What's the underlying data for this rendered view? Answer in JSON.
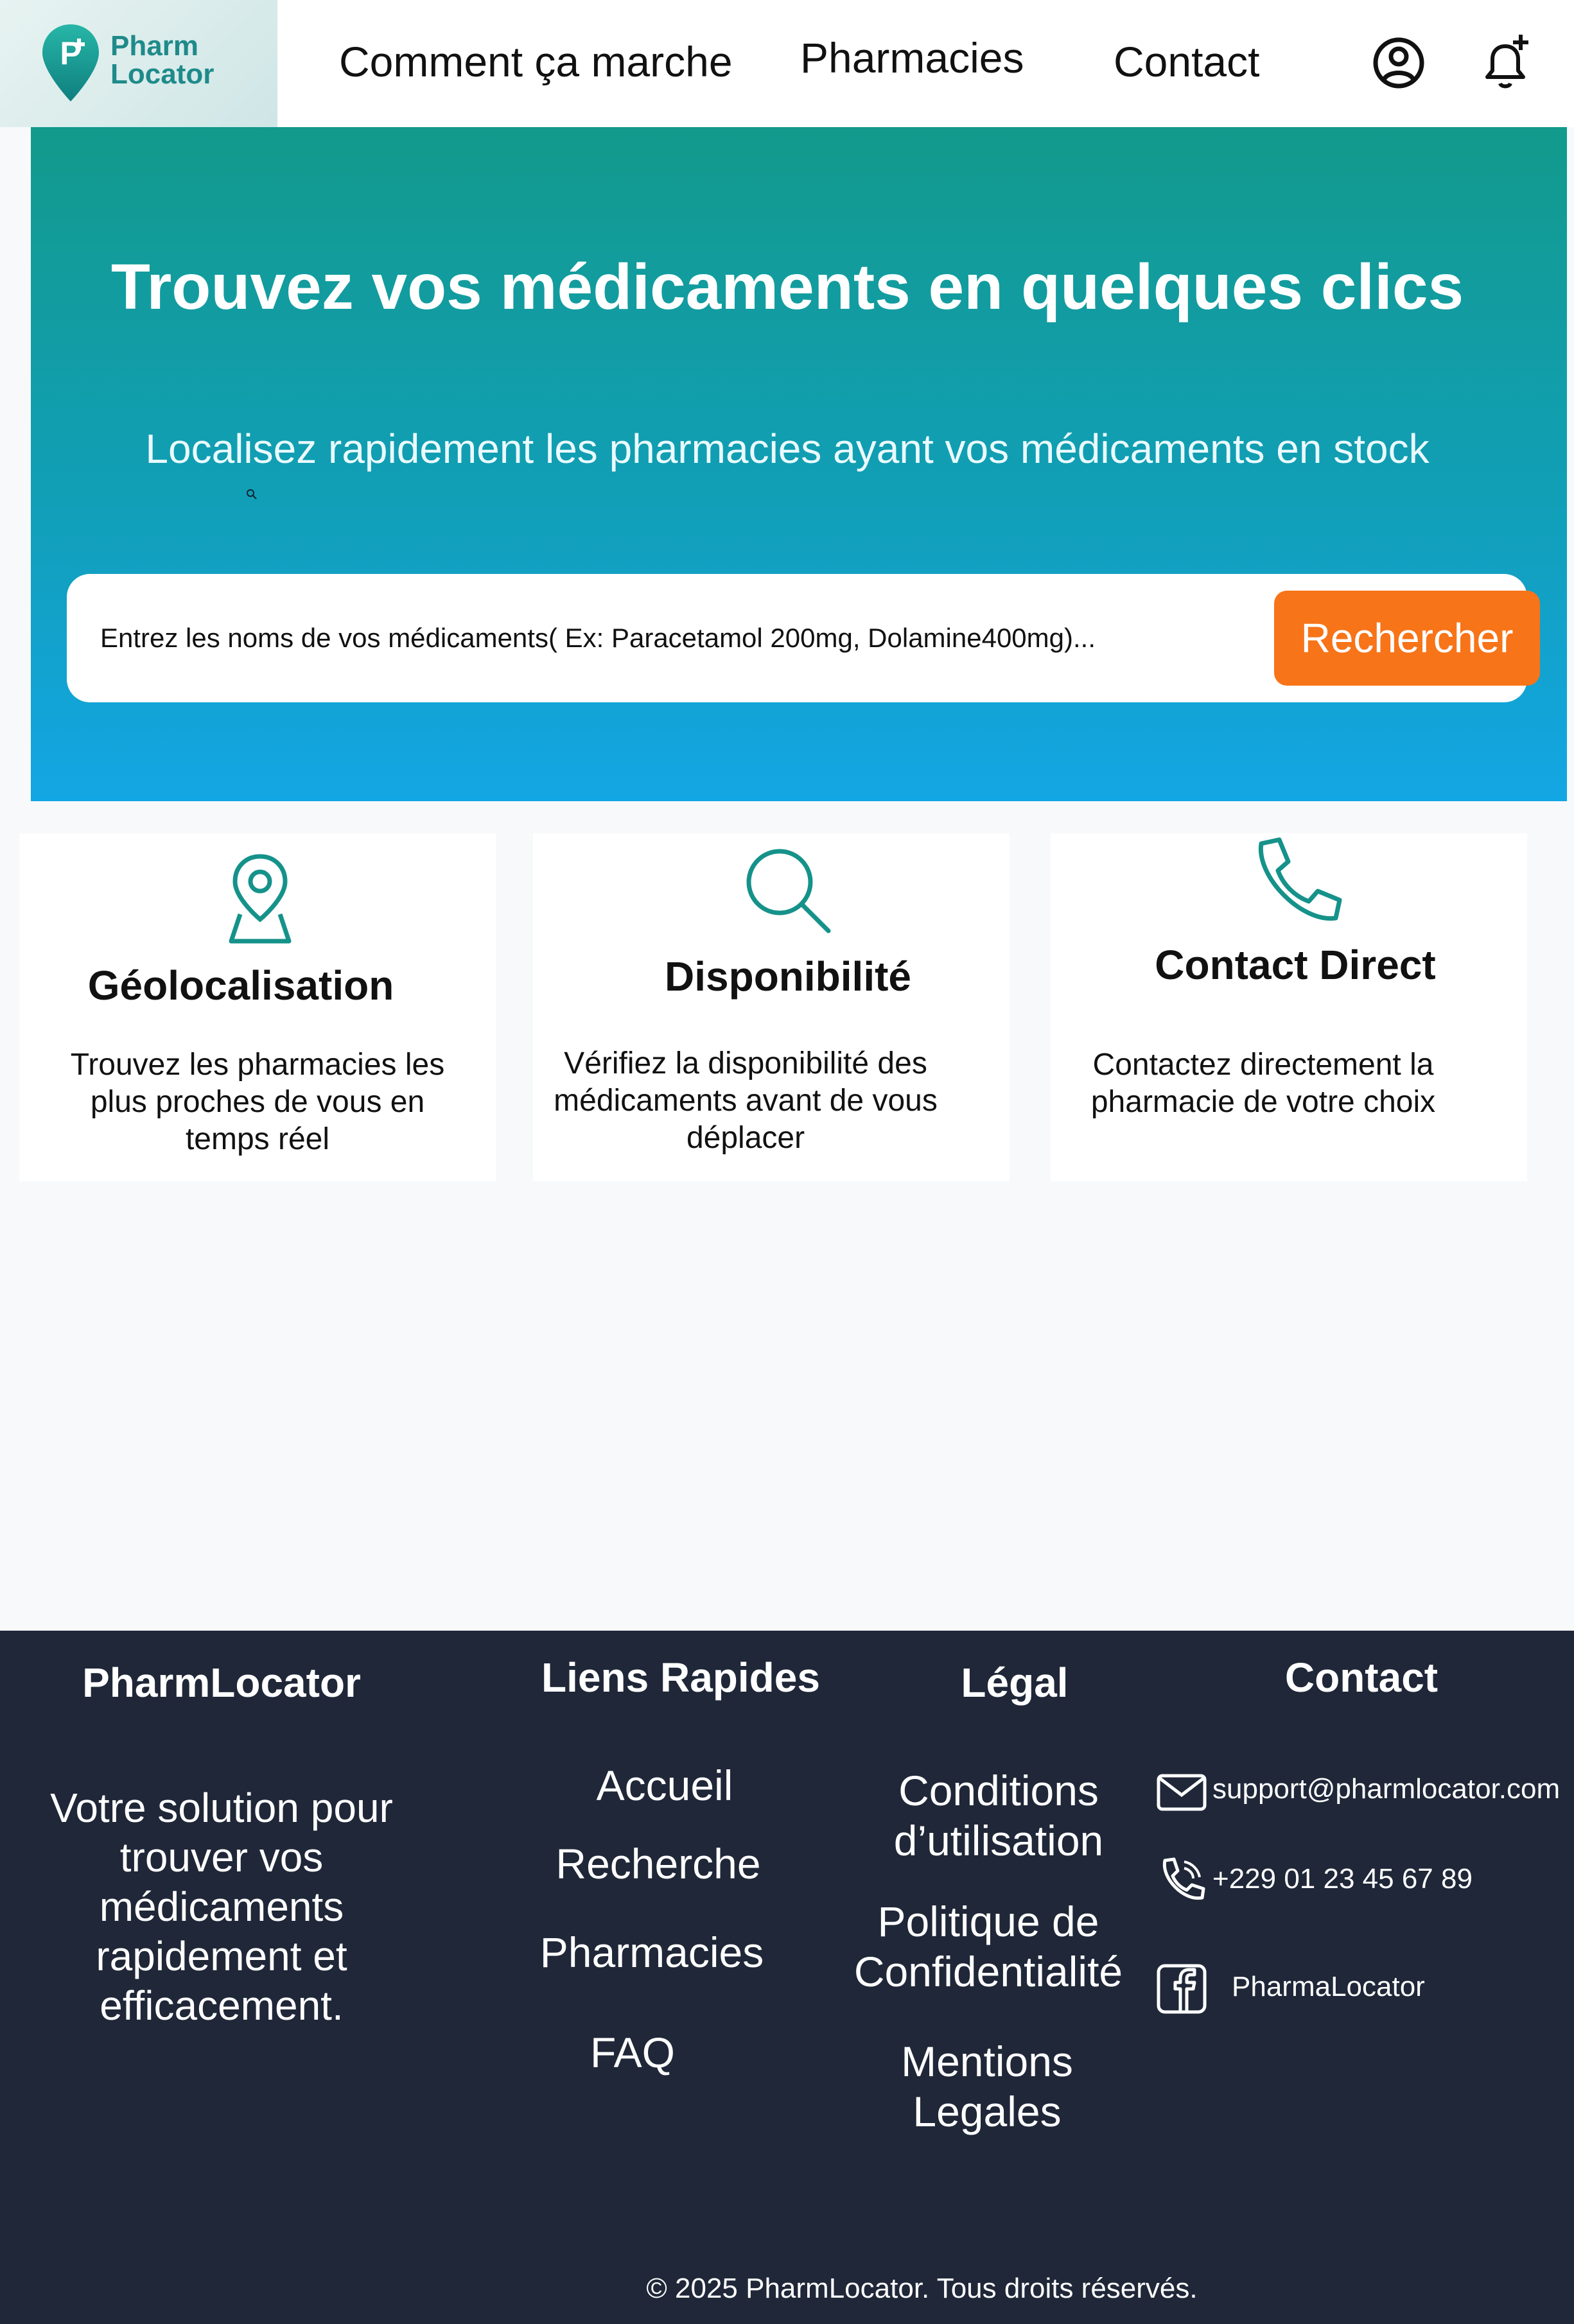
{
  "header": {
    "logo": {
      "line1": "Pharm",
      "line2": "Locator"
    },
    "nav": [
      "Comment ça marche",
      "Pharmacies",
      "Contact"
    ],
    "icons": {
      "account": "user-circle-icon",
      "notifications": "bell-plus-icon"
    }
  },
  "hero": {
    "title": "Trouvez vos médicaments en quelques clics",
    "subtitle": "Localisez rapidement les pharmacies ayant vos médicaments en stock",
    "search": {
      "placeholder": "Entrez les noms de vos médicaments( Ex: Paracetamol 200mg, Dolamine400mg)...",
      "button": "Rechercher"
    }
  },
  "features": [
    {
      "icon": "map-pin-icon",
      "title": "Géolocalisation",
      "text": "Trouvez les pharmacies les plus proches de vous en temps réel"
    },
    {
      "icon": "search-icon",
      "title": "Disponibilité",
      "text": "Vérifiez la disponibilité des médicaments avant de vous déplacer"
    },
    {
      "icon": "phone-icon",
      "title": "Contact Direct",
      "text": "Contactez directement la pharmacie de votre choix"
    }
  ],
  "footer": {
    "brand": {
      "title": "PharmLocator",
      "description": "Votre solution pour trouver vos médicaments rapidement et efficacement."
    },
    "quick_links": {
      "title": "Liens Rapides",
      "items": [
        "Accueil",
        "Recherche",
        "Pharmacies",
        "FAQ"
      ]
    },
    "legal": {
      "title": "Légal",
      "items": [
        "Conditions d’utilisation",
        "Politique de Confidentialité",
        "Mentions Legales"
      ]
    },
    "contact": {
      "title": "Contact",
      "email": "support@pharmlocator.com",
      "phone": "+229 01 23 45 67 89",
      "facebook": "PharmaLocator"
    },
    "copyright": "© 2025 PharmLocator. Tous droits réservés."
  },
  "colors": {
    "brand_teal": "#129a8c",
    "hero_blue": "#13a6e4",
    "accent_orange": "#f77419",
    "footer_bg": "#1f2738",
    "icon_teal": "#15928a"
  }
}
